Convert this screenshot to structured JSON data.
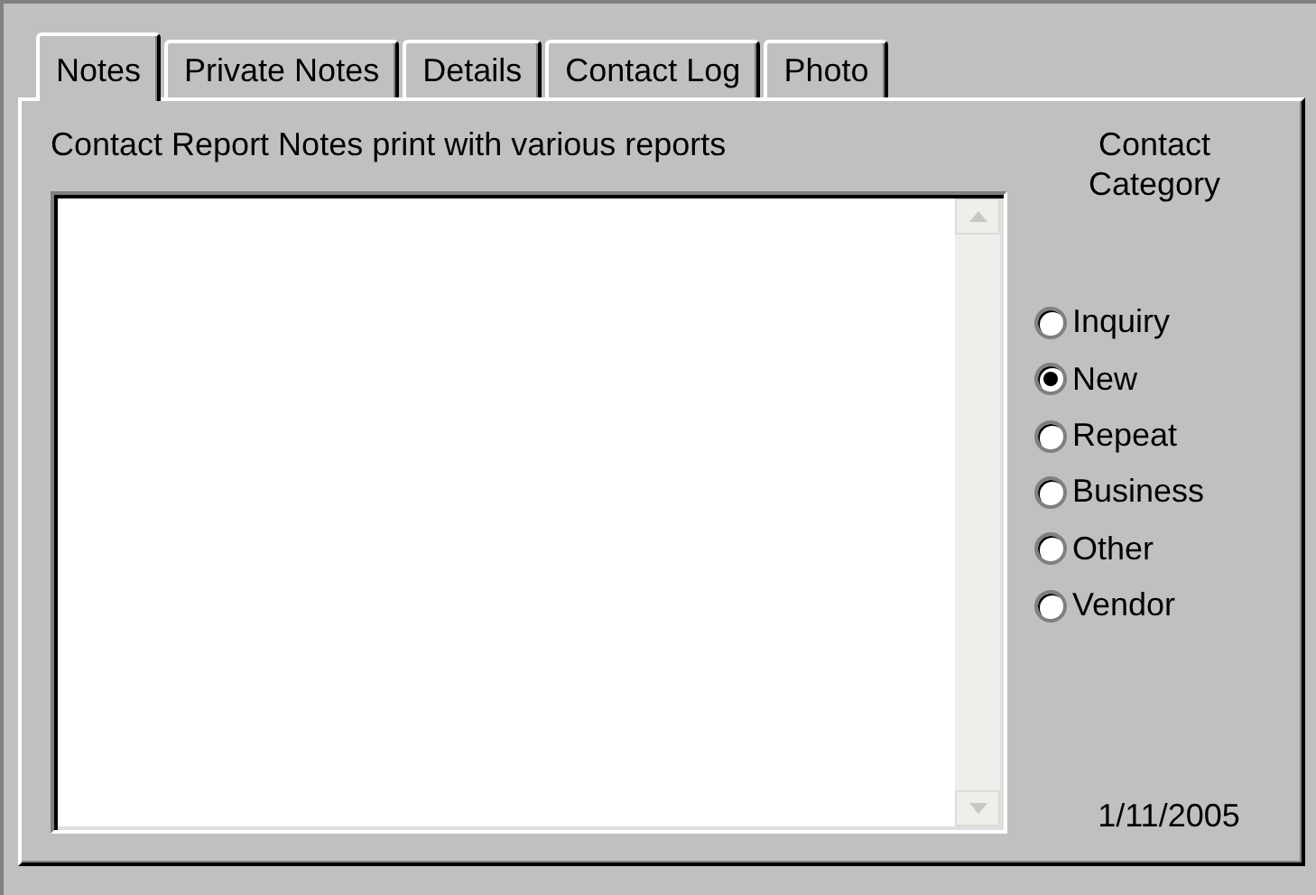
{
  "tabs": [
    {
      "label": "Notes",
      "selected": true
    },
    {
      "label": "Private Notes",
      "selected": false
    },
    {
      "label": "Details",
      "selected": false
    },
    {
      "label": "Contact Log",
      "selected": false
    },
    {
      "label": "Photo",
      "selected": false
    }
  ],
  "notes_label": "Contact Report Notes print with various reports",
  "category": {
    "title": "Contact Category",
    "options": [
      {
        "label": "Inquiry",
        "selected": false
      },
      {
        "label": "New",
        "selected": true
      },
      {
        "label": "Repeat",
        "selected": false
      },
      {
        "label": "Business",
        "selected": false
      },
      {
        "label": "Other",
        "selected": false
      },
      {
        "label": "Vendor",
        "selected": false
      }
    ]
  },
  "date": "1/11/2005"
}
